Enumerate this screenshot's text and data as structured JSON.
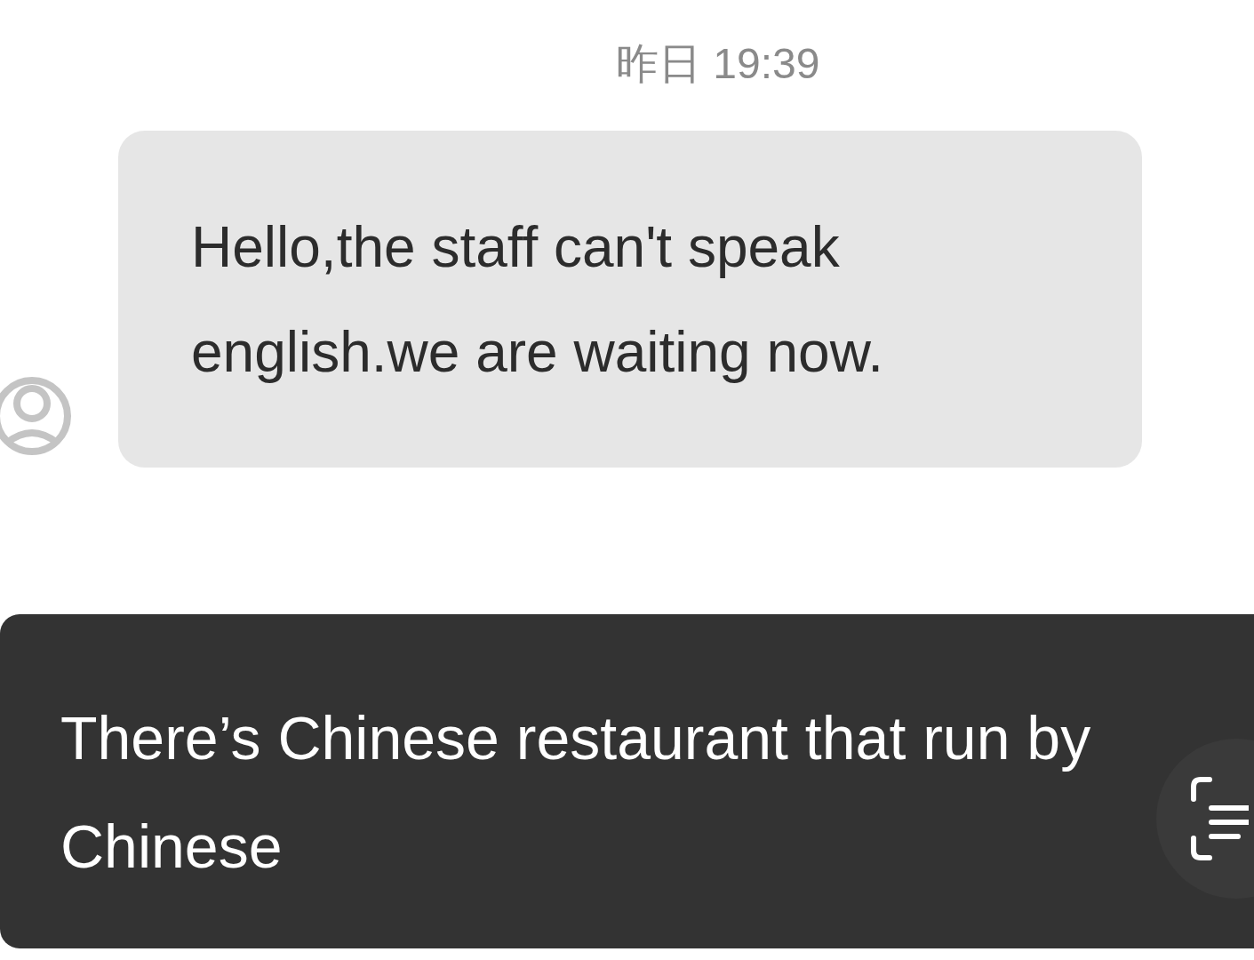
{
  "timestamp": "昨日 19:39",
  "messages": [
    {
      "kind": "received",
      "text": "Hello,the staff can't speak english.we are waiting now."
    }
  ],
  "translation_card": {
    "text": "There’s Chinese restaurant that run by Chinese"
  }
}
